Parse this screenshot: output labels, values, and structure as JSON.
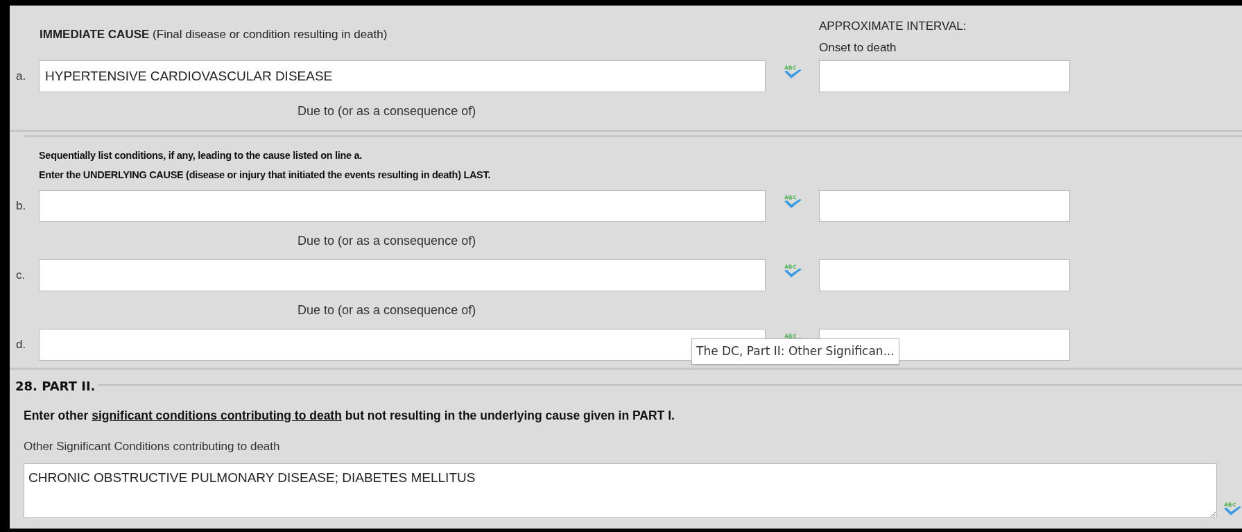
{
  "part1": {
    "heading": "**IMMEDIATE CAUSE** (Final disease or condition resulting in death)",
    "interval_heading": "APPROXIMATE INTERVAL:",
    "interval_subheading": "Onset to death",
    "instructions": [
      "Sequentially list conditions, if any, leading to the cause listed on line a.",
      "Enter the UNDERLYING CAUSE (disease or injury that initiated the events resulting in death) LAST."
    ],
    "lines": [
      {
        "letter": "a.",
        "value": "HYPERTENSIVE CARDIOVASCULAR DISEASE",
        "due_to": "Due to (or as a consequence of)"
      },
      {
        "letter": "b.",
        "due_to": "Due to (or as a consequence of)"
      },
      {
        "letter": "c.",
        "due_to": "Due to (or as a consequence of)"
      },
      {
        "letter": "d."
      }
    ]
  },
  "part2": {
    "legend": "28. PART II.",
    "instruction": {
      "before": "Enter other ",
      "link": "significant conditions contributing to death",
      "after": " but not resulting in the underlying cause given in PART I."
    },
    "field_label": "Other Significant Conditions contributing to death",
    "value": "CHRONIC OBSTRUCTIVE PULMONARY DISEASE; DIABETES MELLITUS"
  },
  "tooltip": {
    "text": "The DC, Part II: Other Significan..."
  }
}
